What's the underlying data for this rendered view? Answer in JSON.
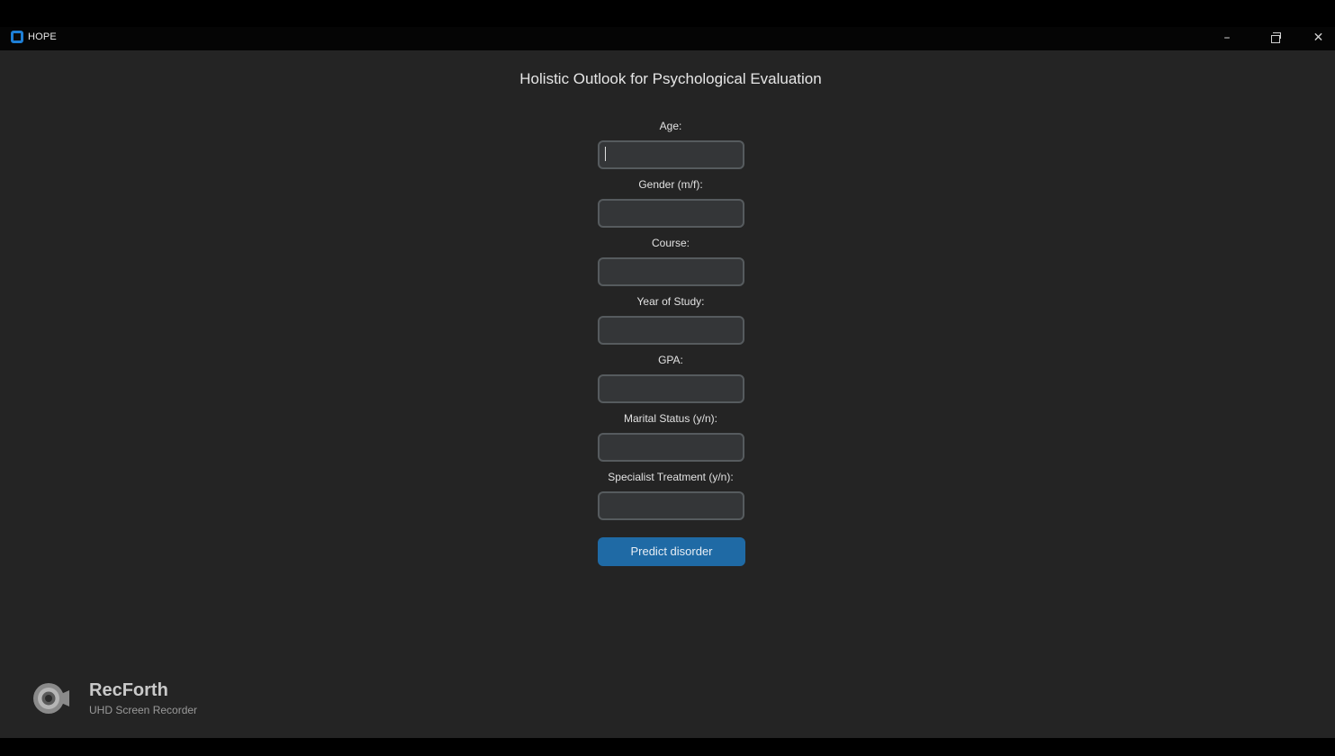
{
  "window": {
    "title": "HOPE",
    "minimize_glyph": "–",
    "close_glyph": "✕"
  },
  "heading": "Holistic Outlook for Psychological Evaluation",
  "form": {
    "fields": [
      {
        "label": "Age:",
        "value": ""
      },
      {
        "label": "Gender (m/f):",
        "value": ""
      },
      {
        "label": "Course:",
        "value": ""
      },
      {
        "label": "Year of Study:",
        "value": ""
      },
      {
        "label": "GPA:",
        "value": ""
      },
      {
        "label": "Marital Status (y/n):",
        "value": ""
      },
      {
        "label": "Specialist Treatment (y/n):",
        "value": ""
      }
    ],
    "submit_label": "Predict disorder"
  },
  "watermark": {
    "name": "RecForth",
    "subtitle": "UHD Screen Recorder"
  },
  "colors": {
    "accent": "#1f6aa5",
    "background": "#242424",
    "input_background": "#343638",
    "input_border": "#565b5e"
  },
  "icons": {
    "app": "app-icon",
    "camera": "camera-icon"
  }
}
